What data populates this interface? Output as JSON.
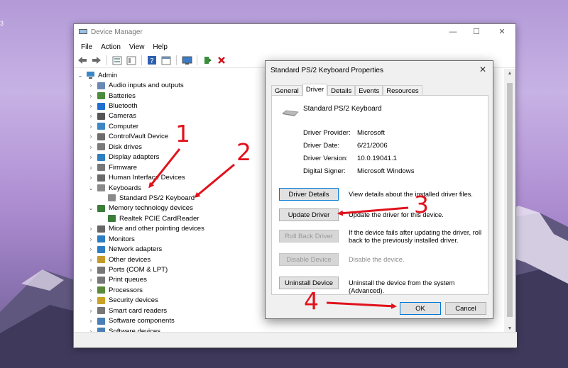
{
  "window": {
    "title": "Device Manager"
  },
  "window_controls": {
    "minimize": "—",
    "maximize": "☐",
    "close": "✕"
  },
  "menu": [
    "File",
    "Action",
    "View",
    "Help"
  ],
  "toolbar_icons": [
    "back-icon",
    "forward-icon",
    "properties-icon",
    "show-hide-icon",
    "help-icon",
    "view-icon",
    "monitor-icon",
    "enable-device-icon",
    "uninstall-icon"
  ],
  "tree": {
    "root": "Admin",
    "items": [
      {
        "label": "Audio inputs and outputs",
        "chev": "›",
        "color": "#6a88b4",
        "indent": 1
      },
      {
        "label": "Batteries",
        "chev": "›",
        "color": "#4b8b3b",
        "indent": 1
      },
      {
        "label": "Bluetooth",
        "chev": "›",
        "color": "#1f6fd1",
        "indent": 1
      },
      {
        "label": "Cameras",
        "chev": "›",
        "color": "#555555",
        "indent": 1
      },
      {
        "label": "Computer",
        "chev": "›",
        "color": "#3d86c6",
        "indent": 1
      },
      {
        "label": "ControlVault Device",
        "chev": "›",
        "color": "#6d6d6d",
        "indent": 1
      },
      {
        "label": "Disk drives",
        "chev": "›",
        "color": "#7a7a7a",
        "indent": 1
      },
      {
        "label": "Display adapters",
        "chev": "›",
        "color": "#2f7fc1",
        "indent": 1
      },
      {
        "label": "Firmware",
        "chev": "›",
        "color": "#777777",
        "indent": 1
      },
      {
        "label": "Human Interface Devices",
        "chev": "›",
        "color": "#6a6a6a",
        "indent": 1
      },
      {
        "label": "Keyboards",
        "chev": "⌄",
        "color": "#8a8a8a",
        "indent": 1
      },
      {
        "label": "Standard PS/2 Keyboard",
        "chev": "",
        "color": "#8a8a8a",
        "indent": 2
      },
      {
        "label": "Memory technology devices",
        "chev": "⌄",
        "color": "#3c7d3a",
        "indent": 1
      },
      {
        "label": "Realtek PCIE CardReader",
        "chev": "",
        "color": "#3c7d3a",
        "indent": 2
      },
      {
        "label": "Mice and other pointing devices",
        "chev": "›",
        "color": "#666666",
        "indent": 1
      },
      {
        "label": "Monitors",
        "chev": "›",
        "color": "#2d7dc4",
        "indent": 1
      },
      {
        "label": "Network adapters",
        "chev": "›",
        "color": "#2d7dc4",
        "indent": 1
      },
      {
        "label": "Other devices",
        "chev": "›",
        "color": "#c69a2a",
        "indent": 1
      },
      {
        "label": "Ports (COM & LPT)",
        "chev": "›",
        "color": "#777777",
        "indent": 1
      },
      {
        "label": "Print queues",
        "chev": "›",
        "color": "#777777",
        "indent": 1
      },
      {
        "label": "Processors",
        "chev": "›",
        "color": "#5a8a3a",
        "indent": 1
      },
      {
        "label": "Security devices",
        "chev": "›",
        "color": "#c9a227",
        "indent": 1
      },
      {
        "label": "Smart card readers",
        "chev": "›",
        "color": "#777777",
        "indent": 1
      },
      {
        "label": "Software components",
        "chev": "›",
        "color": "#4a7fb5",
        "indent": 1
      },
      {
        "label": "Software devices",
        "chev": "›",
        "color": "#4a7fb5",
        "indent": 1
      }
    ]
  },
  "dialog": {
    "title": "Standard PS/2 Keyboard Properties",
    "close": "✕",
    "tabs": [
      "General",
      "Driver",
      "Details",
      "Events",
      "Resources"
    ],
    "active_tab": "Driver",
    "device_name": "Standard PS/2 Keyboard",
    "info": [
      {
        "label": "Driver Provider:",
        "value": "Microsoft"
      },
      {
        "label": "Driver Date:",
        "value": "6/21/2006"
      },
      {
        "label": "Driver Version:",
        "value": "10.0.19041.1"
      },
      {
        "label": "Digital Signer:",
        "value": "Microsoft Windows"
      }
    ],
    "buttons": [
      {
        "label": "Driver Details",
        "desc": "View details about the installed driver files.",
        "enabled": true
      },
      {
        "label": "Update Driver",
        "desc": "Update the driver for this device.",
        "enabled": true
      },
      {
        "label": "Roll Back Driver",
        "desc": "If the device fails after updating the driver, roll back to the previously installed driver.",
        "enabled": false
      },
      {
        "label": "Disable Device",
        "desc": "Disable the device.",
        "enabled": false
      },
      {
        "label": "Uninstall Device",
        "desc": "Uninstall the device from the system (Advanced).",
        "enabled": true
      }
    ],
    "ok": "OK",
    "cancel": "Cancel"
  },
  "annotations": {
    "arrow_color": "#e0121c",
    "labels": [
      "1",
      "2",
      "3",
      "4"
    ]
  }
}
